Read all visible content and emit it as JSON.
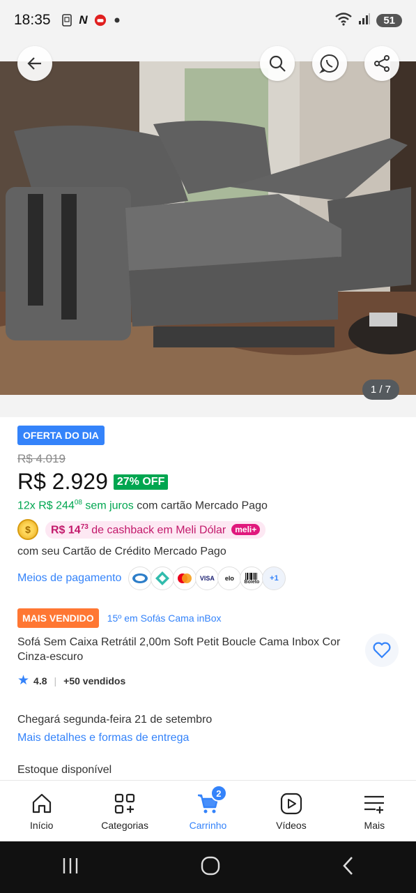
{
  "status_bar": {
    "time": "18:35",
    "battery": "51"
  },
  "gallery": {
    "counter": "1 / 7"
  },
  "product": {
    "deal_badge": "OFERTA DO DIA",
    "old_price": "R$ 4.019",
    "price": "R$ 2.929",
    "discount": "27% OFF",
    "installments_prefix": "12x R$ 244",
    "installments_cents": "08",
    "installments_suffix": " sem juros",
    "installments_card": " com cartão Mercado Pago",
    "cashback_amount": "R$ 14",
    "cashback_cents": "73",
    "cashback_text": " de cashback em Meli Dólar",
    "meli_plus": "meli+",
    "card_line": "com seu Cartão de Crédito Mercado Pago",
    "payment_link": "Meios de pagamento",
    "payment_more": "+1",
    "payment_visa": "VISA",
    "payment_elo": "elo",
    "payment_boleto": "Boleto",
    "best_seller_badge": "MAIS VENDIDO",
    "rank": "15º em Sofás Cama inBox",
    "title": "Sofá Sem Caixa Retrátil 2,00m Soft Petit Boucle Cama Inbox Cor Cinza-escuro",
    "rating": "4.8",
    "sold": "+50 vendidos",
    "delivery": "Chegará segunda-feira 21 de setembro",
    "delivery_link": "Mais detalhes e formas de entrega",
    "stock": "Estoque disponível"
  },
  "bottom_nav": {
    "items": [
      {
        "label": "Início",
        "icon": "home-icon"
      },
      {
        "label": "Categorias",
        "icon": "categories-icon"
      },
      {
        "label": "Carrinho",
        "icon": "cart-icon",
        "badge": "2"
      },
      {
        "label": "Vídeos",
        "icon": "video-icon"
      },
      {
        "label": "Mais",
        "icon": "menu-icon"
      }
    ]
  },
  "colors": {
    "accent_blue": "#3483fa",
    "discount_green": "#00a650",
    "best_seller_orange": "#ff7733",
    "cashback_pink": "#e0197d"
  }
}
